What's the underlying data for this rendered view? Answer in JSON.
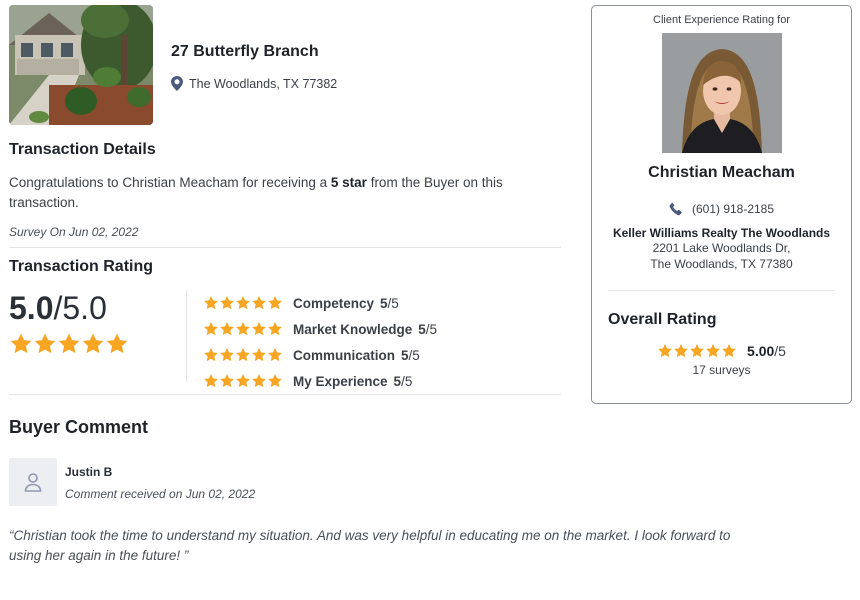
{
  "colors": {
    "star": "#f6a623",
    "accent_icon": "#4b5b7f"
  },
  "property": {
    "address": "27 Butterfly Branch",
    "city": "The Woodlands, TX 77382",
    "photo_icon": "house-photo"
  },
  "transaction_details": {
    "title": "Transaction Details",
    "text_before": "Congratulations to Christian Meacham for receiving a ",
    "text_bold": "5 star",
    "text_after": " from the Buyer on this transaction.",
    "survey_date": "Survey On Jun 02, 2022"
  },
  "transaction_rating": {
    "title": "Transaction Rating",
    "overall_value": "5.0",
    "overall_max": "/5.0",
    "stars": 5,
    "categories": [
      {
        "label": "Competency",
        "score": "5",
        "max": "/5",
        "stars": 5
      },
      {
        "label": "Market Knowledge",
        "score": "5",
        "max": "/5",
        "stars": 5
      },
      {
        "label": "Communication",
        "score": "5",
        "max": "/5",
        "stars": 5
      },
      {
        "label": "My Experience",
        "score": "5",
        "max": "/5",
        "stars": 5
      }
    ]
  },
  "buyer_comment": {
    "title": "Buyer Comment",
    "name": "Justin B",
    "received": "Comment received on Jun 02, 2022",
    "text": "“Christian took the time to understand my situation. And was very helpful in educating me on the market. I look forward to using her again in the future! ”"
  },
  "agent_card": {
    "label": "Client Experience Rating for",
    "name": "Christian Meacham",
    "phone": "(601) 918-2185",
    "company": "Keller Williams Realty The Woodlands",
    "address_line1": "2201 Lake Woodlands Dr,",
    "address_line2": "The Woodlands, TX 77380",
    "overall_title": "Overall Rating",
    "overall_score": "5.00",
    "overall_max": "/5",
    "overall_stars": 5,
    "surveys": "17 surveys"
  }
}
